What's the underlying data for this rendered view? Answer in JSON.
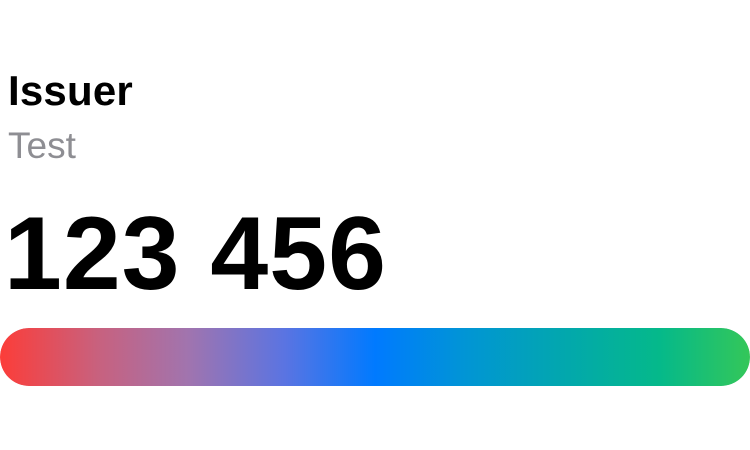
{
  "token": {
    "issuer": "Issuer",
    "account": "Test",
    "code": "123 456",
    "progress_fraction": 1.0
  },
  "colors": {
    "gradient_start": "#fc3d39",
    "gradient_mid": "#007aff",
    "gradient_end": "#34c759",
    "secondary_text": "#8e8e93"
  }
}
